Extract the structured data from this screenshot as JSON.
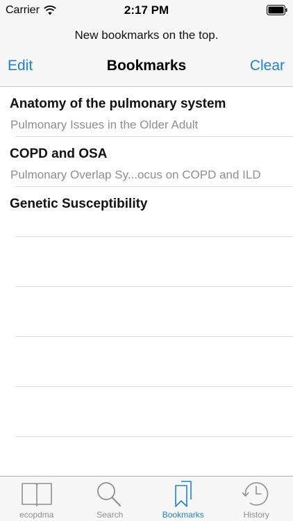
{
  "status_bar": {
    "carrier": "Carrier",
    "time": "2:17 PM"
  },
  "prompt": "New bookmarks on the top.",
  "nav": {
    "edit_label": "Edit",
    "title": "Bookmarks",
    "clear_label": "Clear"
  },
  "bookmarks": [
    {
      "title": "Anatomy of the pulmonary system",
      "subtitle": "Pulmonary Issues in the Older Adult"
    },
    {
      "title": "COPD and OSA",
      "subtitle": "Pulmonary Overlap Sy...ocus on COPD and ILD"
    },
    {
      "title": "Genetic Susceptibility",
      "subtitle": ""
    }
  ],
  "tabs": [
    {
      "label": "ecopdma",
      "icon": "book-icon",
      "active": false
    },
    {
      "label": "Search",
      "icon": "search-icon",
      "active": false
    },
    {
      "label": "Bookmarks",
      "icon": "bookmarks-icon",
      "active": true
    },
    {
      "label": "History",
      "icon": "history-icon",
      "active": false
    }
  ],
  "colors": {
    "accent": "#1a82d6",
    "inactive": "#8e8e93",
    "bar_background": "#f7f7f7"
  }
}
